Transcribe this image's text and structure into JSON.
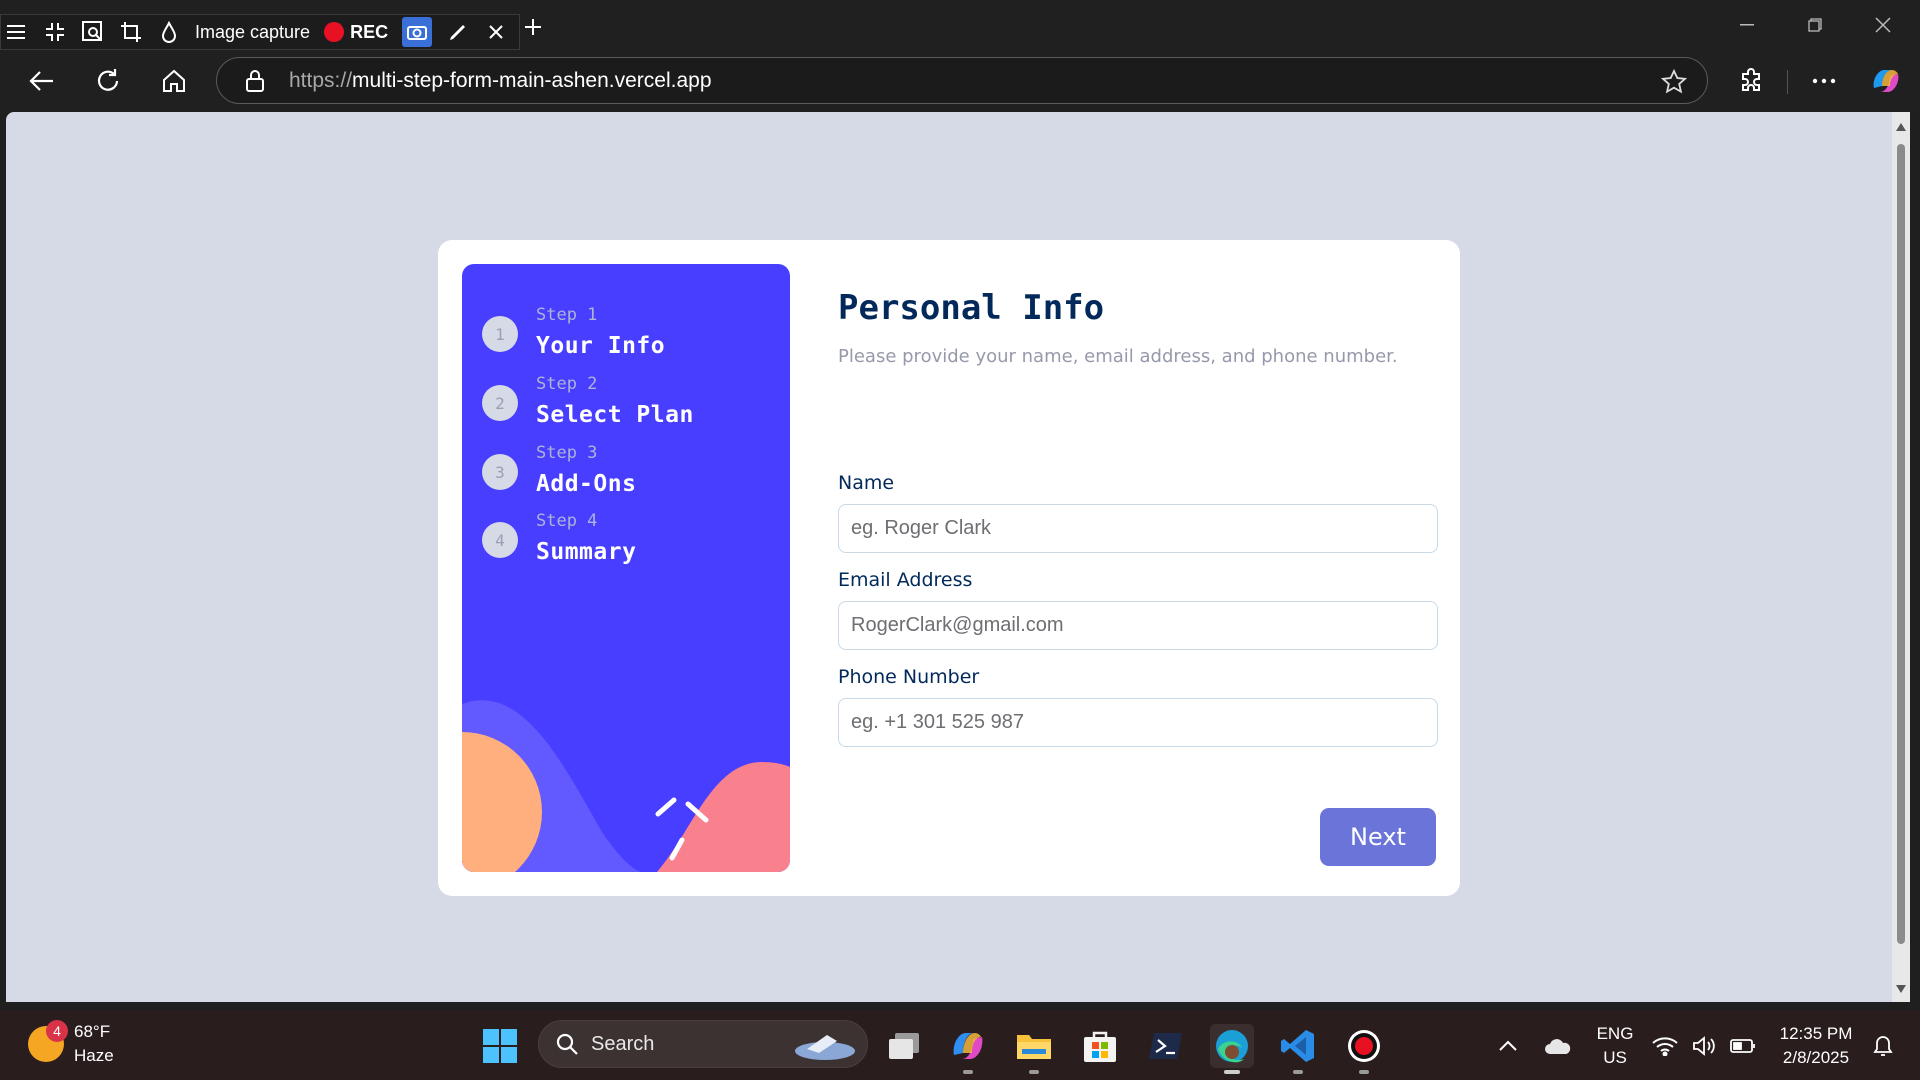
{
  "capture_toolbar": {
    "label": "Image capture",
    "rec_label": "REC"
  },
  "browser": {
    "url_scheme": "https://",
    "url_host": "multi-step-form-main-ashen.vercel.app"
  },
  "form": {
    "steps": [
      {
        "number": "1",
        "kicker": "Step 1",
        "title": "Your Info"
      },
      {
        "number": "2",
        "kicker": "Step 2",
        "title": "Select Plan"
      },
      {
        "number": "3",
        "kicker": "Step 3",
        "title": "Add-Ons"
      },
      {
        "number": "4",
        "kicker": "Step 4",
        "title": "Summary"
      }
    ],
    "title": "Personal Info",
    "subtitle": "Please provide your name, email address, and phone number.",
    "fields": {
      "name": {
        "label": "Name",
        "placeholder": "eg. Roger Clark"
      },
      "email": {
        "label": "Email Address",
        "placeholder": "RogerClark@gmail.com"
      },
      "phone": {
        "label": "Phone Number",
        "placeholder": "eg. +1 301 525 987"
      }
    },
    "next_label": "Next"
  },
  "taskbar": {
    "weather_temp": "68°F",
    "weather_desc": "Haze",
    "weather_badge": "4",
    "search_label": "Search",
    "lang_primary": "ENG",
    "lang_region": "US",
    "time": "12:35 PM",
    "date": "2/8/2025"
  },
  "colors": {
    "sidebar": "#483eff",
    "title": "#02295a",
    "next_button": "#6b74d9",
    "page_background": "#d6dae6"
  }
}
